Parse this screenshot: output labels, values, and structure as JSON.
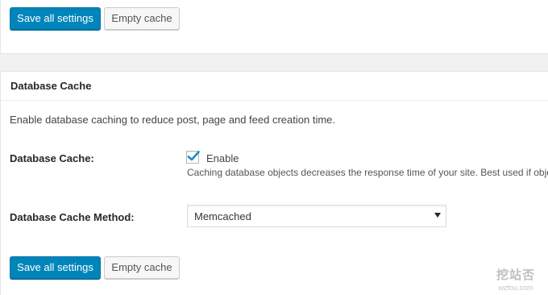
{
  "top_toolbar": {
    "save_label": "Save all settings",
    "empty_cache_label": "Empty cache"
  },
  "database_cache_box": {
    "title": "Database Cache",
    "description": "Enable database caching to reduce post, page and feed creation time.",
    "enable_row": {
      "label": "Database Cache:",
      "checkbox_label": "Enable",
      "checked": true,
      "help_text": "Caching database objects decreases the response time of your site. Best used if object caching is not possible."
    },
    "method_row": {
      "label": "Database Cache Method:",
      "selected_value": "Memcached"
    },
    "save_label": "Save all settings",
    "empty_cache_label": "Empty cache"
  },
  "watermark": {
    "logo_text": "挖站否",
    "url": "wzfou.com"
  },
  "colors": {
    "primary_button": "#0085ba",
    "checkmark": "#1e8cbe"
  }
}
